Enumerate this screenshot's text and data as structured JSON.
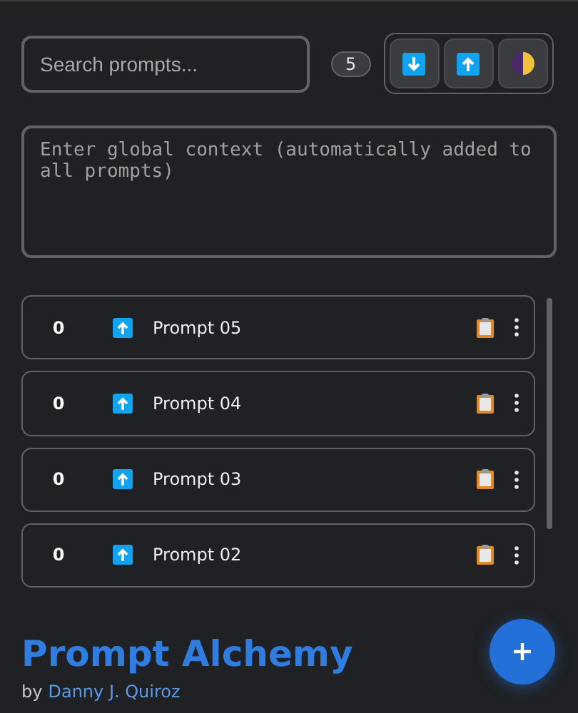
{
  "search": {
    "placeholder": "Search prompts..."
  },
  "prompt_count": "5",
  "context": {
    "placeholder": "Enter global context (automatically added to all prompts)"
  },
  "prompts": [
    {
      "count": "0",
      "title": "Prompt 05"
    },
    {
      "count": "0",
      "title": "Prompt 04"
    },
    {
      "count": "0",
      "title": "Prompt 03"
    },
    {
      "count": "0",
      "title": "Prompt 02"
    }
  ],
  "footer": {
    "title": "Prompt Alchemy",
    "by": "by",
    "author": "Danny J. Quiroz"
  }
}
